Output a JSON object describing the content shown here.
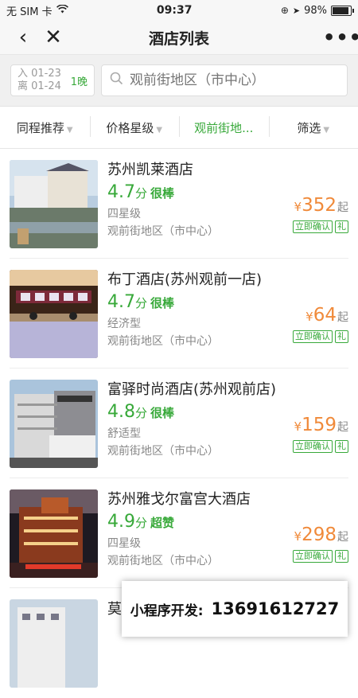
{
  "status": {
    "carrier": "无 SIM 卡",
    "time": "09:37",
    "battery": "98%",
    "battery_level": 0.98
  },
  "nav": {
    "title": "酒店列表"
  },
  "search": {
    "checkin": "入 01-23",
    "checkout": "离 01-24",
    "nights": "1晚",
    "placeholder": "观前街地区（市中心）"
  },
  "filters": [
    {
      "label": "同程推荐"
    },
    {
      "label": "价格星级"
    },
    {
      "label": "观前街地..."
    },
    {
      "label": "筛选"
    }
  ],
  "hotels": [
    {
      "name": "苏州凯莱酒店",
      "score": "4.7",
      "unit": "分",
      "rating": "很棒",
      "grade": "四星级",
      "area": "观前街地区（市中心）",
      "yen": "¥",
      "price": "352",
      "qi": "起",
      "tag1": "立即确认",
      "tag2": "礼"
    },
    {
      "name": "布丁酒店(苏州观前一店)",
      "score": "4.7",
      "unit": "分",
      "rating": "很棒",
      "grade": "经济型",
      "area": "观前街地区（市中心）",
      "yen": "¥",
      "price": "64",
      "qi": "起",
      "tag1": "立即确认",
      "tag2": "礼"
    },
    {
      "name": "富驿时尚酒店(苏州观前店)",
      "score": "4.8",
      "unit": "分",
      "rating": "很棒",
      "grade": "舒适型",
      "area": "观前街地区（市中心）",
      "yen": "¥",
      "price": "159",
      "qi": "起",
      "tag1": "立即确认",
      "tag2": "礼"
    },
    {
      "name": "苏州雅戈尔富宫大酒店",
      "score": "4.9",
      "unit": "分",
      "rating": "超赞",
      "grade": "四星级",
      "area": "观前街地区（市中心）",
      "yen": "¥",
      "price": "298",
      "qi": "起",
      "tag1": "立即确认",
      "tag2": "礼"
    },
    {
      "name": "莫",
      "score": "",
      "unit": "",
      "rating": "",
      "grade": "",
      "area": "",
      "yen": "",
      "price": "",
      "qi": "",
      "tag1": "",
      "tag2": ""
    }
  ],
  "overlay": {
    "label": "小程序开发:",
    "phone": "13691612727"
  },
  "colors": {
    "accent": "#38a93a",
    "price": "#f08a3a"
  }
}
